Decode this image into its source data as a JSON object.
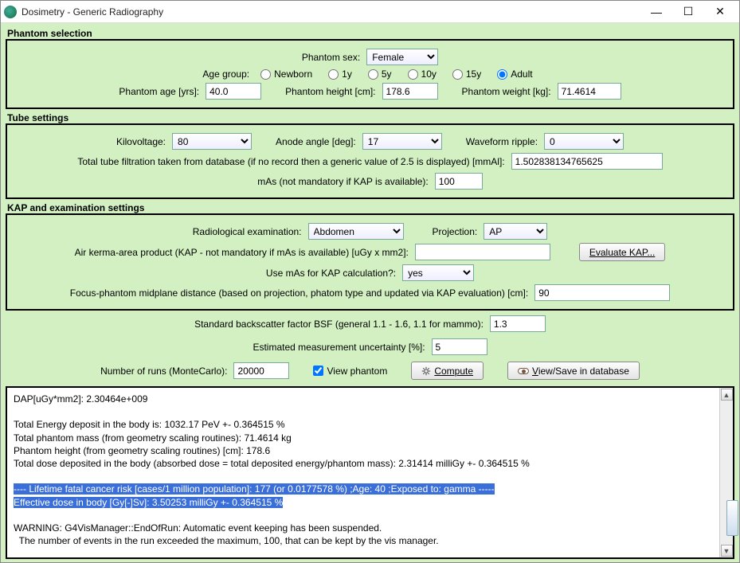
{
  "window": {
    "title": "Dosimetry - Generic Radiography"
  },
  "phantom": {
    "heading": "Phantom selection",
    "sex_label": "Phantom sex:",
    "sex_value": "Female",
    "age_group_label": "Age group:",
    "age_options": {
      "newborn": "Newborn",
      "y1": "1y",
      "y5": "5y",
      "y10": "10y",
      "y15": "15y",
      "adult": "Adult"
    },
    "age_label": "Phantom age [yrs]:",
    "age_value": "40.0",
    "height_label": "Phantom height [cm]:",
    "height_value": "178.6",
    "weight_label": "Phantom weight [kg]:",
    "weight_value": "71.4614"
  },
  "tube": {
    "heading": "Tube settings",
    "kv_label": "Kilovoltage:",
    "kv_value": "80",
    "anode_label": "Anode angle [deg]:",
    "anode_value": "17",
    "ripple_label": "Waveform ripple:",
    "ripple_value": "0",
    "filtration_label": "Total tube filtration taken from database (if no record then a generic value of 2.5 is displayed) [mmAl]:",
    "filtration_value": "1.502838134765625",
    "mas_label": "mAs (not mandatory if KAP is available):",
    "mas_value": "100"
  },
  "kap": {
    "heading": "KAP and examination settings",
    "exam_label": "Radiological examination:",
    "exam_value": "Abdomen",
    "proj_label": "Projection:",
    "proj_value": "AP",
    "kap_label": "Air kerma-area product (KAP - not mandatory if mAs is available) [uGy x mm2]:",
    "kap_value": "",
    "eval_button": "Evaluate KAP...",
    "use_mas_label": "Use mAs for KAP calculation?:",
    "use_mas_value": "yes",
    "focus_label": "Focus-phantom midplane distance (based on projection, phatom type and updated via KAP evaluation) [cm]:",
    "focus_value": "90"
  },
  "extra": {
    "bsf_label": "Standard backscatter factor BSF (general 1.1 - 1.6, 1.1 for mammo):",
    "bsf_value": "1.3",
    "unc_label": "Estimated measurement uncertainty [%]:",
    "unc_value": "5",
    "runs_label": "Number of runs (MonteCarlo):",
    "runs_value": "20000",
    "view_phantom": "View phantom",
    "compute": "Compute",
    "viewsave": "View/Save in database"
  },
  "output": {
    "line1": "DAP[uGy*mm2]: 2.30464e+009",
    "line2": "Total Energy deposit in the body is: 1032.17 PeV +- 0.364515 %",
    "line3": "Total phantom mass (from geometry scaling routines): 71.4614 kg",
    "line4": "Phantom height (from geometry scaling routines) [cm]: 178.6",
    "line5": "Total dose deposited in the body (absorbed dose = total deposited energy/phantom mass): 2.31414 milliGy +- 0.364515 %",
    "hl1": "---- Lifetime fatal cancer risk [cases/1 million population]: 177 (or 0.0177578 %) ;Age: 40 ;Exposed to: gamma -----",
    "hl2": "Effective dose in body [Gy[-]Sv]: 3.50253 milliGy +- 0.364515 %",
    "line6": "WARNING: G4VisManager::EndOfRun: Automatic event keeping has been suspended.",
    "line7": "  The number of events in the run exceeded the maximum, 100, that can be kept by the vis manager."
  }
}
